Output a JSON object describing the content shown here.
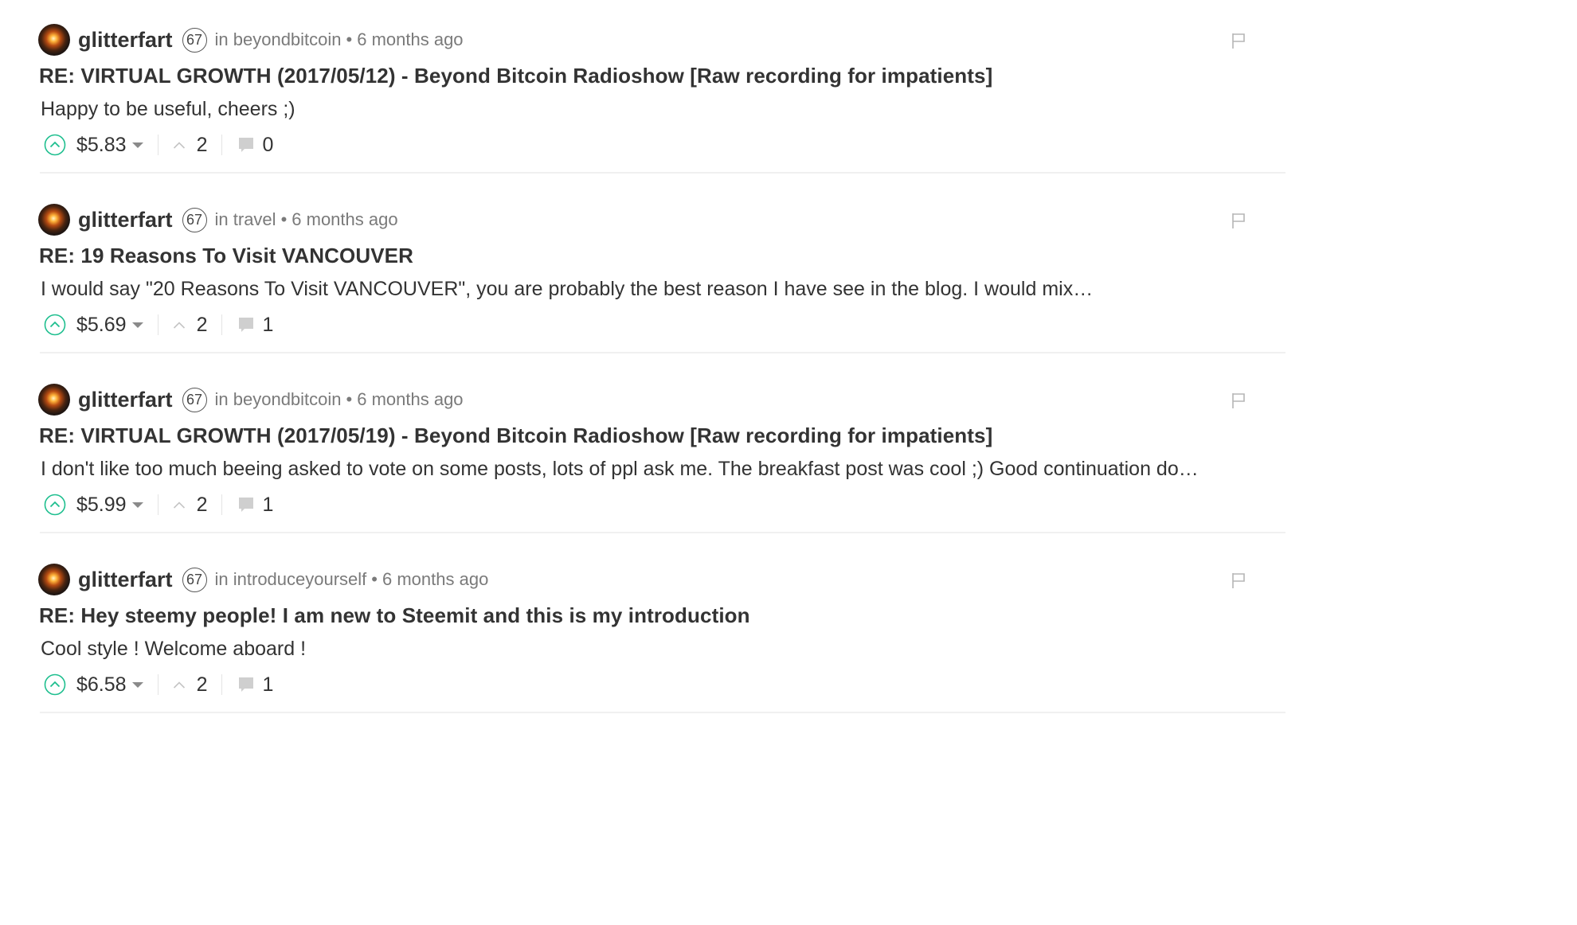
{
  "comments": [
    {
      "author": "glitterfart",
      "reputation": "67",
      "community": "in beyondbitcoin",
      "separator": "•",
      "time": "6 months ago",
      "title": "RE: VIRTUAL GROWTH (2017/05/12) - Beyond Bitcoin Radioshow [Raw recording for impatients]",
      "body": "Happy to be useful, cheers ;)",
      "payout": "$5.83",
      "votes": "2",
      "replies": "0"
    },
    {
      "author": "glitterfart",
      "reputation": "67",
      "community": "in travel",
      "separator": "•",
      "time": "6 months ago",
      "title": "RE: 19 Reasons To Visit VANCOUVER",
      "body": "I would say \"20 Reasons To Visit VANCOUVER\", you are probably the best reason I have see in the blog. I would mix…",
      "payout": "$5.69",
      "votes": "2",
      "replies": "1"
    },
    {
      "author": "glitterfart",
      "reputation": "67",
      "community": "in beyondbitcoin",
      "separator": "•",
      "time": "6 months ago",
      "title": "RE: VIRTUAL GROWTH (2017/05/19) - Beyond Bitcoin Radioshow [Raw recording for impatients]",
      "body": "I don't like too much beeing asked to vote on some posts, lots of ppl ask me. The breakfast post was cool ;) Good continuation do…",
      "payout": "$5.99",
      "votes": "2",
      "replies": "1"
    },
    {
      "author": "glitterfart",
      "reputation": "67",
      "community": "in introduceyourself",
      "separator": "•",
      "time": "6 months ago",
      "title": "RE: Hey steemy people! I am new to Steemit and this is my introduction",
      "body": "Cool style ! Welcome aboard !",
      "payout": "$6.58",
      "votes": "2",
      "replies": "1"
    }
  ],
  "icons": {
    "avatar": "avatar-image",
    "upvote": "upvote-icon",
    "payout_dropdown": "chevron-down-icon",
    "votes": "votes-icon",
    "replies": "reply-icon",
    "flag": "flag-icon"
  },
  "colors": {
    "accent": "#1fbf8f",
    "text": "#333333",
    "muted": "#7a7a7a",
    "icon_gray": "#cfcfcf",
    "divider": "#f0f0f0"
  }
}
